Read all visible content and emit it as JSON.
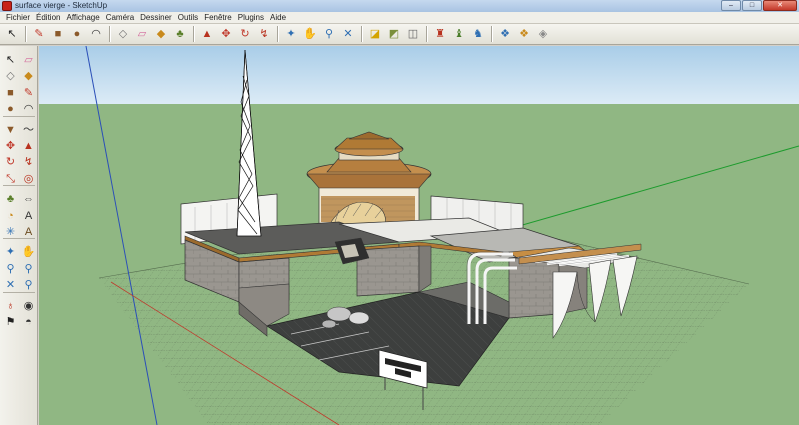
{
  "window": {
    "title": "surface vierge - SketchUp",
    "minimize_glyph": "–",
    "maximize_glyph": "□",
    "close_glyph": "✕"
  },
  "menu": {
    "items": [
      "Fichier",
      "Édition",
      "Affichage",
      "Caméra",
      "Dessiner",
      "Outils",
      "Fenêtre",
      "Plugins",
      "Aide"
    ]
  },
  "toolbar": {
    "groups": [
      [
        {
          "icon": "select-icon",
          "glyph": "↖",
          "color": "#222222"
        }
      ],
      [
        {
          "icon": "pencil-icon",
          "glyph": "✎",
          "color": "#c0392b"
        },
        {
          "icon": "rectangle-icon",
          "glyph": "■",
          "color": "#8b5a2b"
        },
        {
          "icon": "circle-icon",
          "glyph": "●",
          "color": "#8b5a2b"
        },
        {
          "icon": "arc-icon",
          "glyph": "◠",
          "color": "#333333"
        }
      ],
      [
        {
          "icon": "make-component-icon",
          "glyph": "◇",
          "color": "#777777"
        },
        {
          "icon": "eraser-icon",
          "glyph": "▱",
          "color": "#d46a9c"
        },
        {
          "icon": "paint-bucket-icon",
          "glyph": "◆",
          "color": "#c98a1c"
        },
        {
          "icon": "tape-measure-icon",
          "glyph": "♣",
          "color": "#5a7f2a"
        }
      ],
      [
        {
          "icon": "push-pull-icon",
          "glyph": "▲",
          "color": "#b8321f"
        },
        {
          "icon": "move-icon",
          "glyph": "✥",
          "color": "#c0392b"
        },
        {
          "icon": "rotate-icon",
          "glyph": "↻",
          "color": "#c0392b"
        },
        {
          "icon": "follow-me-icon",
          "glyph": "↯",
          "color": "#b8321f"
        }
      ],
      [
        {
          "icon": "orbit-icon",
          "glyph": "✦",
          "color": "#2f6fb3"
        },
        {
          "icon": "pan-icon",
          "glyph": "✋",
          "color": "#555555"
        },
        {
          "icon": "zoom-icon",
          "glyph": "⚲",
          "color": "#2f6fb3"
        },
        {
          "icon": "zoom-extents-icon",
          "glyph": "✕",
          "color": "#2f6fb3"
        }
      ],
      [
        {
          "icon": "add-location-icon",
          "glyph": "◪",
          "color": "#d4a400"
        },
        {
          "icon": "toggle-terrain-icon",
          "glyph": "◩",
          "color": "#7a8f3a"
        },
        {
          "icon": "photo-textures-icon",
          "glyph": "◫",
          "color": "#666666"
        }
      ],
      [
        {
          "icon": "get-models-icon",
          "glyph": "♜",
          "color": "#b8321f"
        },
        {
          "icon": "share-model-icon",
          "glyph": "♝",
          "color": "#4a7d2a"
        },
        {
          "icon": "share-component-icon",
          "glyph": "♞",
          "color": "#2f6fb3"
        }
      ],
      [
        {
          "icon": "get-models-3d-icon",
          "glyph": "❖",
          "color": "#2f6fb3"
        },
        {
          "icon": "extension-warehouse-icon",
          "glyph": "❖",
          "color": "#c98a1c"
        },
        {
          "icon": "layout-icon",
          "glyph": "◈",
          "color": "#888888"
        }
      ]
    ]
  },
  "palette": {
    "tools": [
      {
        "icon": "select-icon",
        "glyph": "↖",
        "color": "#222222"
      },
      {
        "icon": "eraser-icon",
        "glyph": "▱",
        "color": "#d46a9c"
      },
      {
        "icon": "component-icon",
        "glyph": "◇",
        "color": "#777777"
      },
      {
        "icon": "paint-bucket-icon",
        "glyph": "◆",
        "color": "#c98a1c"
      },
      {
        "icon": "rectangle-icon",
        "glyph": "■",
        "color": "#8b5a2b"
      },
      {
        "icon": "pencil-icon",
        "glyph": "✎",
        "color": "#c0392b"
      },
      {
        "icon": "circle-icon",
        "glyph": "●",
        "color": "#8b5a2b"
      },
      {
        "icon": "arc-icon",
        "glyph": "◠",
        "color": "#333333"
      },
      {
        "icon": "polygon-icon",
        "glyph": "▼",
        "color": "#8b5a2b"
      },
      {
        "icon": "freehand-icon",
        "glyph": "〜",
        "color": "#333333"
      },
      {
        "icon": "move-icon",
        "glyph": "✥",
        "color": "#c0392b"
      },
      {
        "icon": "push-pull-icon",
        "glyph": "▲",
        "color": "#b8321f"
      },
      {
        "icon": "rotate-icon",
        "glyph": "↻",
        "color": "#c0392b"
      },
      {
        "icon": "follow-me-icon",
        "glyph": "↯",
        "color": "#b8321f"
      },
      {
        "icon": "scale-icon",
        "glyph": "⤡",
        "color": "#c0392b"
      },
      {
        "icon": "offset-icon",
        "glyph": "◎",
        "color": "#b8321f"
      },
      {
        "icon": "tape-measure-icon",
        "glyph": "♣",
        "color": "#5a7f2a"
      },
      {
        "icon": "dimension-icon",
        "glyph": "⇔",
        "color": "#555555"
      },
      {
        "icon": "protractor-icon",
        "glyph": "◔",
        "color": "#c98a1c"
      },
      {
        "icon": "text-icon",
        "glyph": "A",
        "color": "#333333"
      },
      {
        "icon": "axes-icon",
        "glyph": "✳",
        "color": "#2f6fb3"
      },
      {
        "icon": "3d-text-icon",
        "glyph": "A",
        "color": "#6b4b1f"
      },
      {
        "icon": "orbit-icon",
        "glyph": "✦",
        "color": "#2f6fb3"
      },
      {
        "icon": "pan-icon",
        "glyph": "✋",
        "color": "#555555"
      },
      {
        "icon": "zoom-icon",
        "glyph": "⚲",
        "color": "#2f6fb3"
      },
      {
        "icon": "zoom-window-icon",
        "glyph": "⚲",
        "color": "#2f6fb3"
      },
      {
        "icon": "zoom-extents-icon",
        "glyph": "✕",
        "color": "#2f6fb3"
      },
      {
        "icon": "previous-view-icon",
        "glyph": "⚲",
        "color": "#2f6fb3"
      },
      {
        "icon": "position-camera-icon",
        "glyph": "♁",
        "color": "#b8321f"
      },
      {
        "icon": "look-around-icon",
        "glyph": "◉",
        "color": "#333333"
      },
      {
        "icon": "walk-icon",
        "glyph": "⚑",
        "color": "#222222"
      },
      {
        "icon": "section-plane-icon",
        "glyph": "◓",
        "color": "#333333"
      }
    ]
  },
  "viewport": {
    "sky_color": "#cfe3f2",
    "ground_color": "#90b783",
    "sign_text_line1": "▬▬▬▬",
    "sign_text_line2": "▬▬ ▬"
  }
}
